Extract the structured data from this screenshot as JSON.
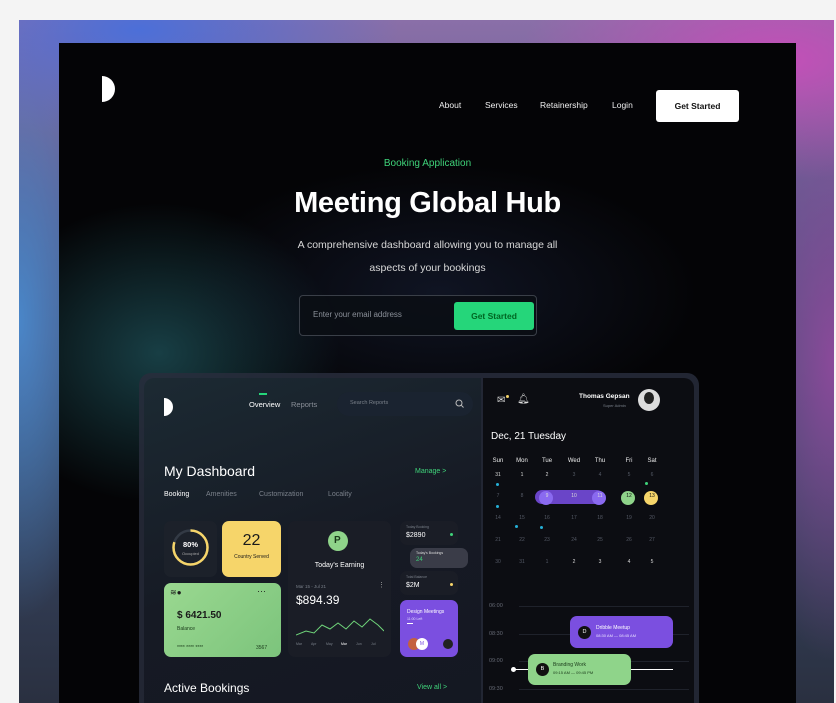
{
  "nav": {
    "about": "About",
    "services": "Services",
    "retainership": "Retainership",
    "login": "Login",
    "cta": "Get Started"
  },
  "hero": {
    "eyebrow": "Booking Application",
    "title": "Meeting Global Hub",
    "subtitle_line1": "A comprehensive dashboard allowing you to manage all",
    "subtitle_line2": "aspects of your bookings",
    "email_placeholder": "Enter your email address",
    "cta": "Get Started"
  },
  "dashboard": {
    "tabs": {
      "overview": "Overview",
      "reports": "Reports"
    },
    "search_placeholder": "Search Reports",
    "title": "My Dashboard",
    "manage": "Manage >",
    "filters": [
      "Booking",
      "Amenities",
      "Customization",
      "Locality"
    ],
    "occupied": {
      "value": "80%",
      "label": "Occupied",
      "fraction": 0.8
    },
    "country": {
      "value": "22",
      "label": "Country Served"
    },
    "earning": {
      "label": "Today's Earning",
      "dates": "Mar 15 - Jul 21",
      "amount": "$894.39",
      "months": [
        "Mar",
        "Apr",
        "May",
        "Mar",
        "Jun",
        "Jul"
      ]
    },
    "card": {
      "amount": "$ 6421.50",
      "label": "Balance",
      "masked": "**** **** ****",
      "last": "3567"
    },
    "stat1": {
      "label": "Today Booking",
      "value": "$2890"
    },
    "stat2": {
      "label": "Today's Bookings",
      "value": "24"
    },
    "stat3": {
      "label": "Total Balance",
      "value": "$2M"
    },
    "design": {
      "title": "Design Meetings",
      "sub": "11:00 Left",
      "avatar": "M"
    },
    "active": "Active Bookings",
    "viewall": "View all >",
    "user": {
      "name": "Thomas Gepsan",
      "role": "Super Admin"
    },
    "date": "Dec, 21 Tuesday",
    "weekdays": [
      "Sun",
      "Mon",
      "Tue",
      "Wed",
      "Thu",
      "Fri",
      "Sat"
    ],
    "weeks": [
      [
        "31",
        "1",
        "2",
        "3",
        "4",
        "5",
        "6"
      ],
      [
        "7",
        "8",
        "9",
        "10",
        "11",
        "12",
        "13"
      ],
      [
        "14",
        "15",
        "16",
        "17",
        "18",
        "19",
        "20"
      ],
      [
        "21",
        "22",
        "23",
        "24",
        "25",
        "26",
        "27"
      ],
      [
        "28",
        "29",
        "30",
        "31",
        "1",
        "2",
        "3"
      ],
      [
        "30",
        "31",
        "1",
        "2",
        "3",
        "4",
        "5"
      ]
    ],
    "times": [
      "06:00",
      "08:30",
      "09:00",
      "09:30",
      "10:00"
    ],
    "event1": {
      "title": "Dribble Meetup",
      "time": "08:30 AM — 08:45 AM",
      "icon": "D"
    },
    "event2": {
      "title": "Branding Work",
      "time": "09:15 AM — 09:45 PM",
      "icon": "B"
    }
  },
  "colors": {
    "green": "#25d67a",
    "purple": "#7b4fe0",
    "yellow": "#f6d56a",
    "lightgreen": "#8fd48a"
  }
}
